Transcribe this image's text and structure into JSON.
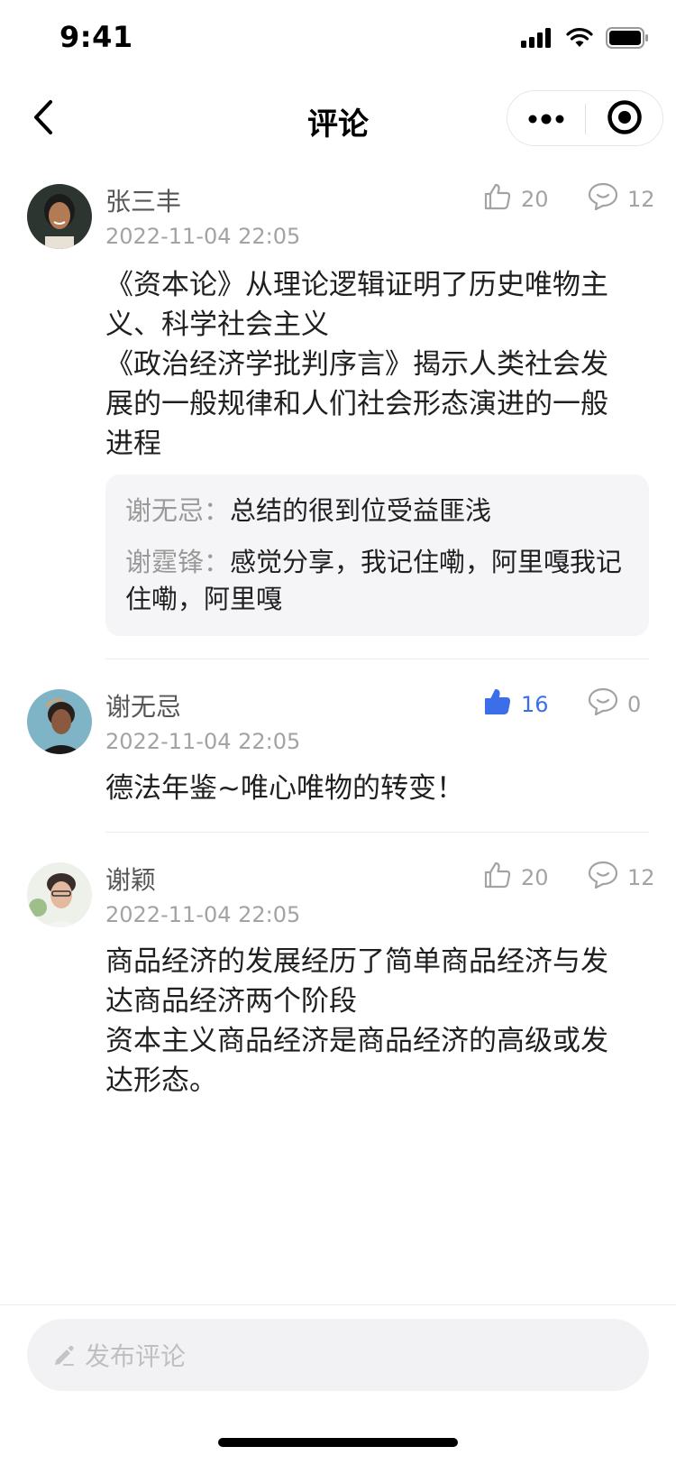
{
  "status_bar": {
    "time": "9:41"
  },
  "nav": {
    "title": "评论"
  },
  "comments": [
    {
      "name": "张三丰",
      "time": "2022-11-04 22:05",
      "likes": "20",
      "replies": "12",
      "liked": false,
      "text": [
        "《资本论》从理论逻辑证明了历史唯物主义、科学社会主义",
        "《政治经济学批判序言》揭示人类社会发展的一般规律和人们社会形态演进的一般进程"
      ],
      "sub_replies": [
        {
          "user": "谢无忌：",
          "text": "总结的很到位受益匪浅"
        },
        {
          "user": "谢霆锋：",
          "text": "感觉分享，我记住嘞，阿里嘎我记住嘞，阿里嘎"
        }
      ]
    },
    {
      "name": "谢无忌",
      "time": "2022-11-04 22:05",
      "likes": "16",
      "replies": "0",
      "liked": true,
      "text": [
        "德法年鉴~唯心唯物的转变！"
      ]
    },
    {
      "name": "谢颖",
      "time": "2022-11-04 22:05",
      "likes": "20",
      "replies": "12",
      "liked": false,
      "text": [
        "商品经济的发展经历了简单商品经济与发达商品经济两个阶段",
        "资本主义商品经济是商品经济的高级或发达形态。"
      ]
    }
  ],
  "input": {
    "placeholder": "发布评论"
  },
  "icons": {
    "back": "chevron-left-icon",
    "more": "more-dots-icon",
    "close": "target-circle-icon",
    "like": "thumbs-up-icon",
    "reply": "comment-bubble-icon",
    "edit": "pencil-icon"
  },
  "colors": {
    "accent": "#3b6ee8",
    "muted": "#a3a3a3"
  }
}
